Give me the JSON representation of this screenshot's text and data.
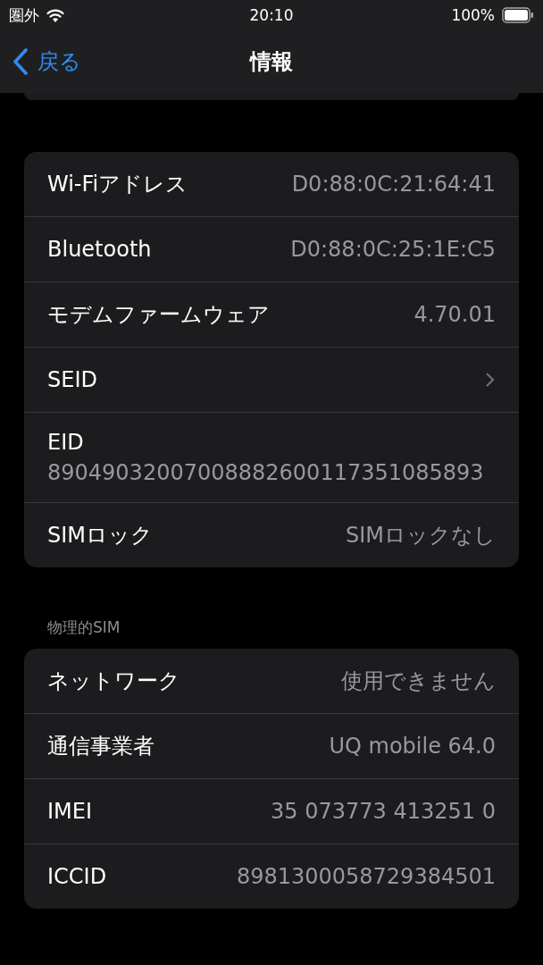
{
  "status_bar": {
    "carrier": "圏外",
    "time": "20:10",
    "battery": "100%"
  },
  "nav": {
    "back": "戻る",
    "title": "情報"
  },
  "sections": [
    {
      "rows": [
        {
          "kind": "value",
          "label": "Wi-Fiアドレス",
          "value": "D0:88:0C:21:64:41"
        },
        {
          "kind": "value",
          "label": "Bluetooth",
          "value": "D0:88:0C:25:1E:C5"
        },
        {
          "kind": "value",
          "label": "モデムファームウェア",
          "value": "4.70.01"
        },
        {
          "kind": "link",
          "label": "SEID"
        },
        {
          "kind": "stacked",
          "label": "EID",
          "value": "89049032007008882600117351085893"
        },
        {
          "kind": "value",
          "label": "SIMロック",
          "value": "SIMロックなし"
        }
      ]
    },
    {
      "header": "物理的SIM",
      "rows": [
        {
          "kind": "value",
          "label": "ネットワーク",
          "value": "使用できません"
        },
        {
          "kind": "value",
          "label": "通信事業者",
          "value": "UQ mobile 64.0"
        },
        {
          "kind": "value",
          "label": "IMEI",
          "value": "35 073773 413251 0"
        },
        {
          "kind": "value",
          "label": "ICCID",
          "value": "8981300058729384501"
        }
      ]
    }
  ]
}
